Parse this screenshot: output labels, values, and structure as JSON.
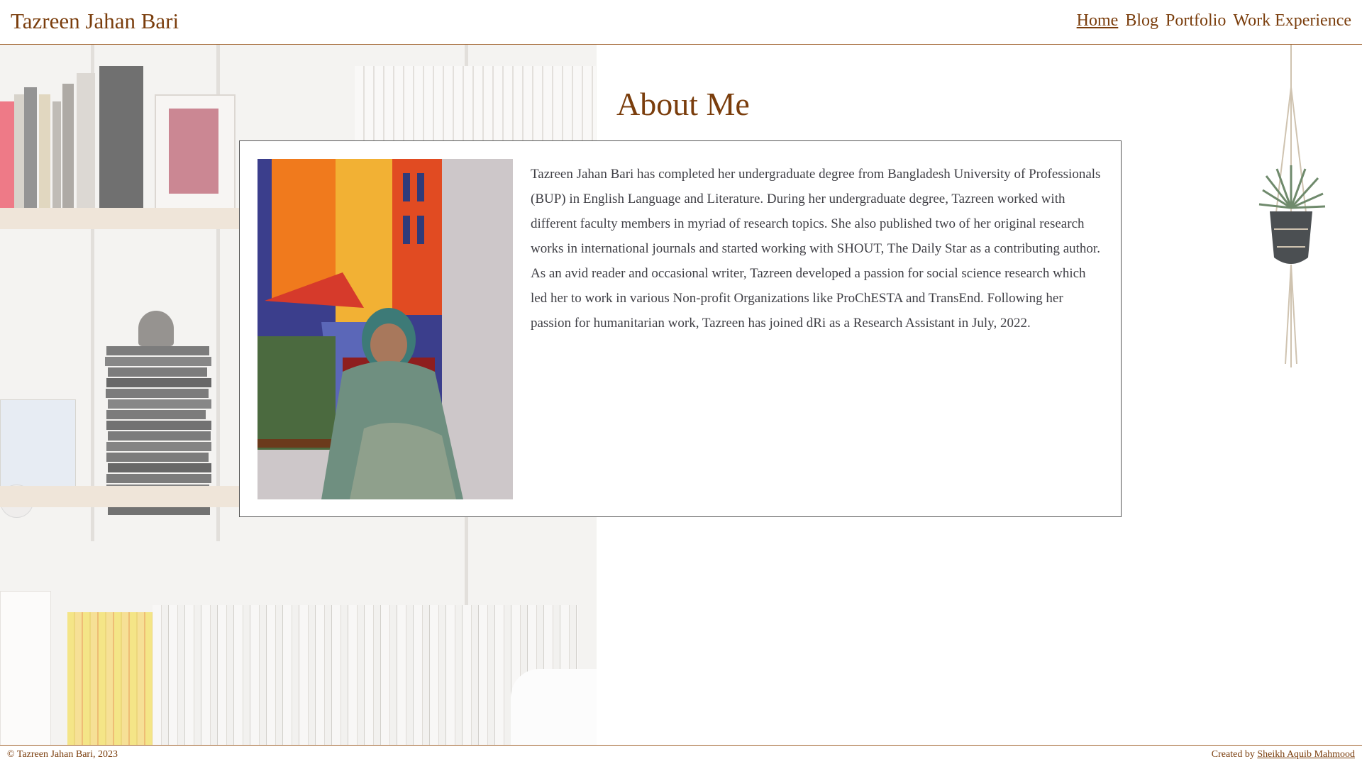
{
  "header": {
    "brand": "Tazreen Jahan Bari",
    "nav": [
      {
        "label": "Home",
        "active": true
      },
      {
        "label": "Blog",
        "active": false
      },
      {
        "label": "Portfolio",
        "active": false
      },
      {
        "label": "Work Experience",
        "active": false
      }
    ]
  },
  "main": {
    "title": "About Me",
    "photo_alt": "Portrait of Tazreen Jahan Bari seated in front of a painting",
    "bio": "Tazreen Jahan Bari has completed her undergraduate degree from Bangladesh University of Professionals (BUP) in English Language and Literature. During her undergraduate degree, Tazreen worked with different faculty members in myriad of research topics. She also published two of her original research works in international journals and started working with SHOUT, The Daily Star as a contributing author. As an avid reader and occasional writer, Tazreen developed a passion for social science research which led her to work in various Non-profit Organizations like ProChESTA and TransEnd. Following her passion for humanitarian work, Tazreen has joined dRi as a Research Assistant in July, 2022."
  },
  "footer": {
    "copyright": "© Tazreen Jahan Bari, 2023",
    "credit_prefix": "Created by",
    "credit_name": "Sheikh Aquib Mahmood"
  },
  "colors": {
    "accent": "#7a3d0c",
    "text": "#3f3f45",
    "rule": "#a0622d"
  }
}
